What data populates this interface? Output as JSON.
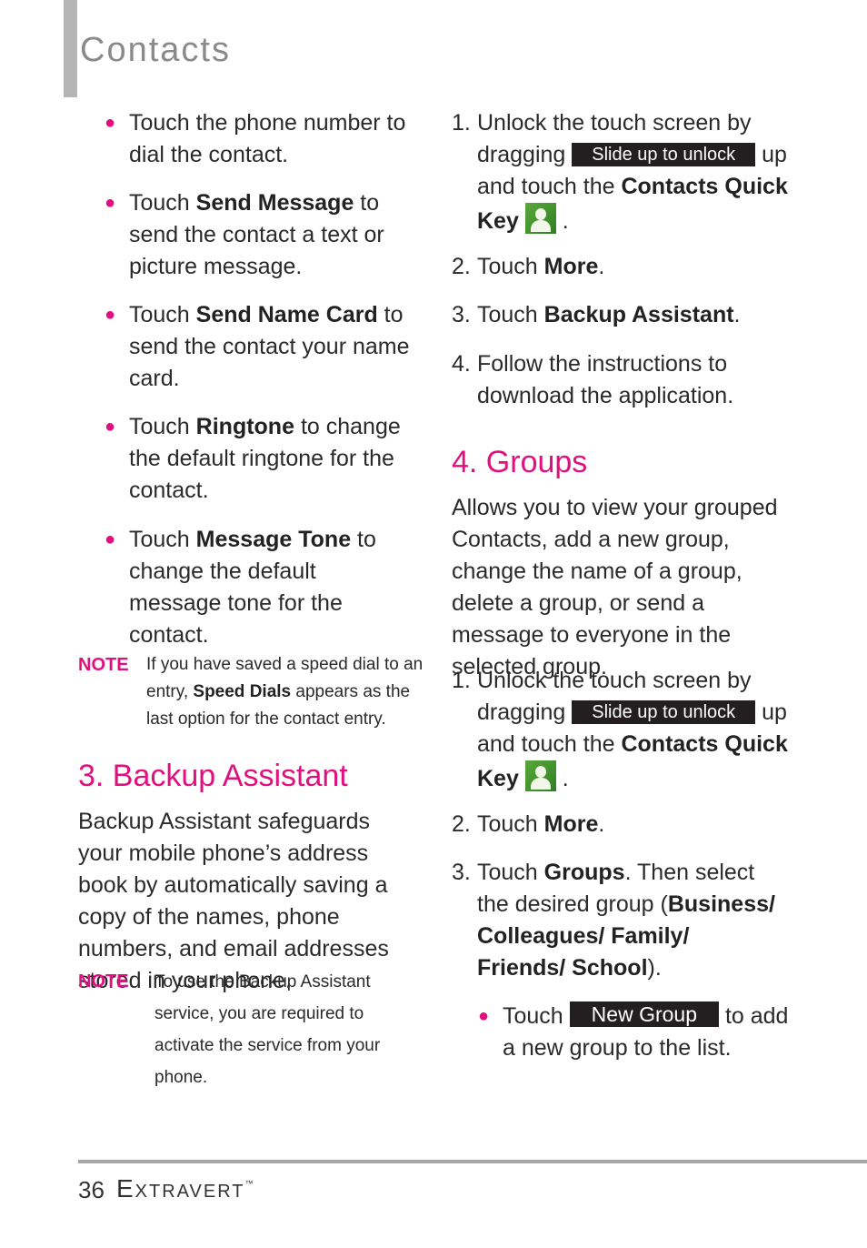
{
  "header": {
    "title": "Contacts"
  },
  "left": {
    "bullets": [
      {
        "pre": "Touch the phone number to dial the contact.",
        "key": "",
        "post": ""
      },
      {
        "pre": "Touch ",
        "key": "Send Message",
        "post": " to send the contact a text or picture message."
      },
      {
        "pre": "Touch ",
        "key": "Send Name Card",
        "post": " to send the contact your name card."
      },
      {
        "pre": "Touch ",
        "key": "Ringtone",
        "post": " to change the default ringtone for the contact."
      },
      {
        "pre": "Touch ",
        "key": "Message Tone",
        "post": " to change the default message tone for the contact."
      }
    ],
    "note1": {
      "label": "NOTE",
      "pre": "If you have saved a speed dial to an entry, ",
      "key": "Speed Dials",
      "post": " appears as the last option for the contact entry."
    },
    "section3": {
      "heading": "3. Backup Assistant",
      "body": "Backup Assistant safeguards your mobile phone’s address book by automatically saving a copy of the names, phone numbers, and email addresses stored in your phone.",
      "note": {
        "label": "NOTE",
        "text": "To use the Backup Assistant service, you are required to activate the service from your phone."
      }
    }
  },
  "right": {
    "backup_steps": [
      {
        "num": "1.",
        "a": "Unlock the touch screen by dragging",
        "pill": "Slide up to unlock",
        "b": "up and touch the",
        "key": "Contacts Quick Key",
        "c": "."
      },
      {
        "num": "2.",
        "pre": "Touch ",
        "key": "More",
        "post": "."
      },
      {
        "num": "3.",
        "pre": "Touch ",
        "key": "Backup Assistant",
        "post": "."
      },
      {
        "num": "4.",
        "pre": "Follow the instructions to download the application.",
        "key": "",
        "post": ""
      }
    ],
    "section4": {
      "heading": "4. Groups",
      "body": "Allows you to view your grouped Contacts, add a new group, change the name of a group, delete a group, or send a message to everyone in the selected group.",
      "steps": [
        {
          "num": "1.",
          "a": "Unlock the touch screen by dragging",
          "pill": "Slide up to unlock",
          "b": "up and touch the",
          "key": "Contacts Quick Key",
          "c": "."
        },
        {
          "num": "2.",
          "pre": "Touch ",
          "key": "More",
          "post": "."
        },
        {
          "num": "3.",
          "pre": "Touch ",
          "key": "Groups",
          "mid": ". Then select the desired group (",
          "groups": "Business/ Colleagues/ Family/ Friends/ School",
          "post": ")."
        }
      ],
      "bullet": {
        "pre": "Touch",
        "pill": "New Group",
        "post": "to add a new group to the list."
      }
    }
  },
  "footer": {
    "page": "36",
    "brand": "Extravert",
    "tm": "™"
  },
  "colors": {
    "accent": "#e0117f",
    "pill_bg": "#231f20",
    "title_gray": "#8a8a8a"
  }
}
